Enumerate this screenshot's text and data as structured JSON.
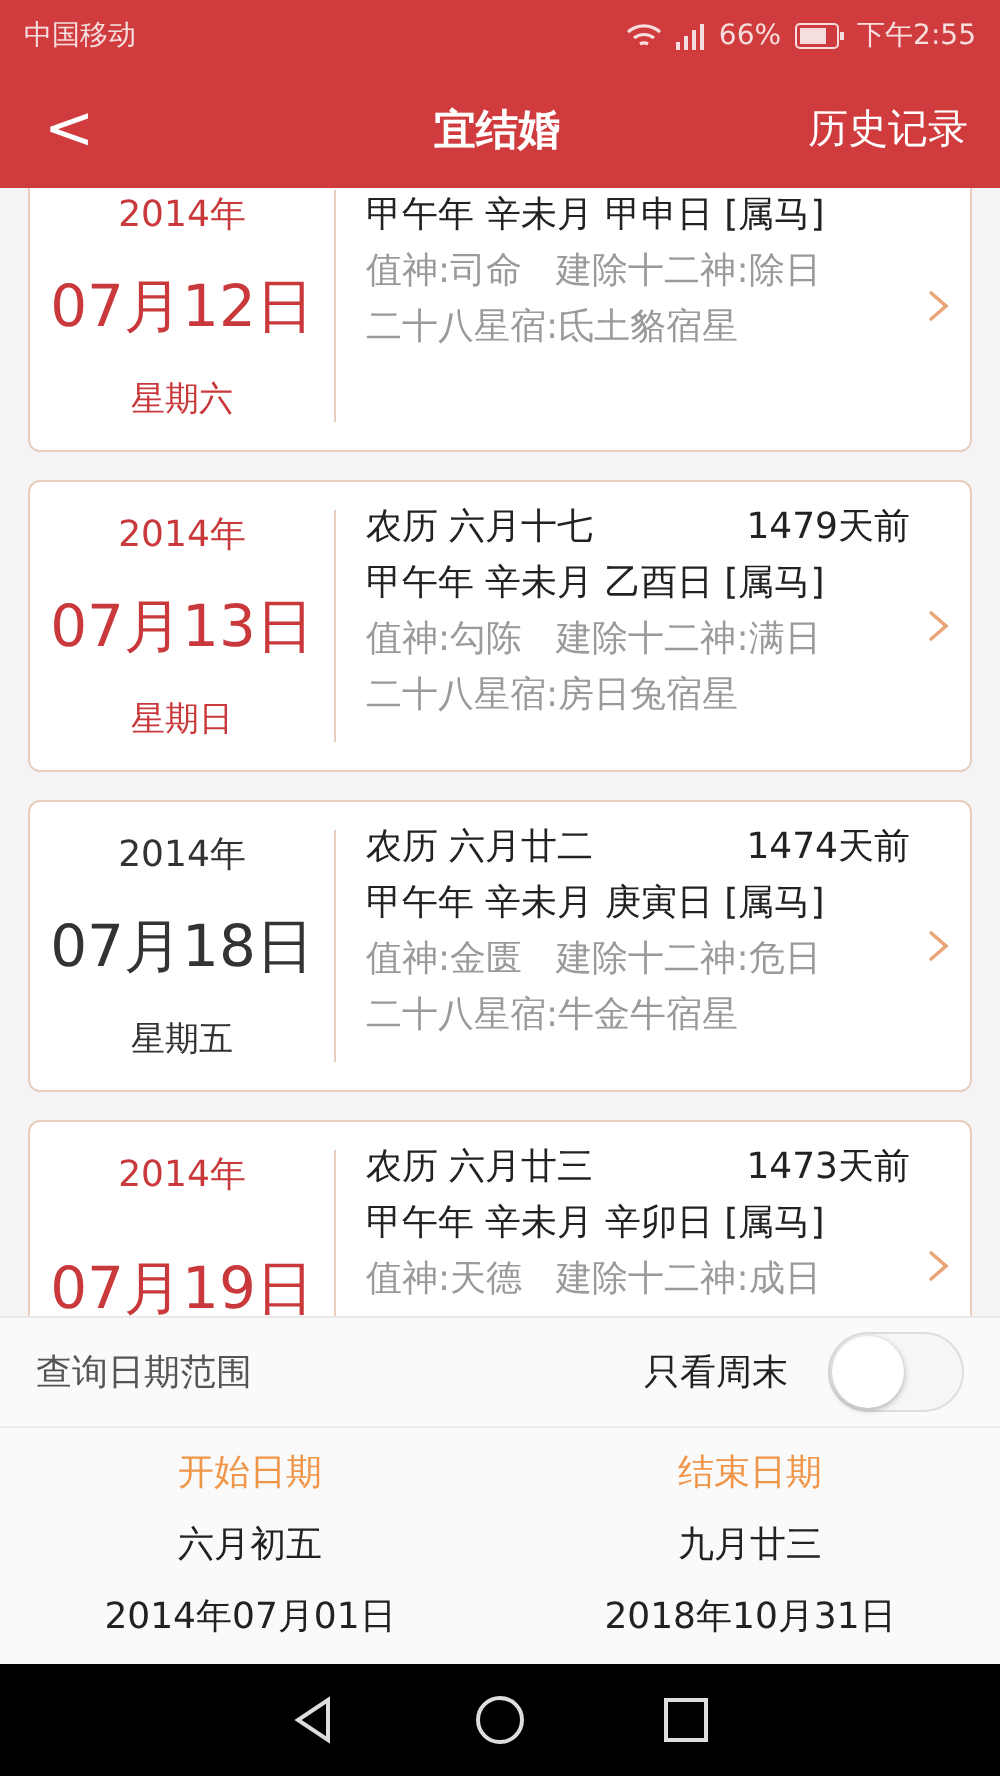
{
  "status_bar": {
    "carrier": "中国移动",
    "battery": "66%",
    "time": "下午2:55"
  },
  "header": {
    "back": "<",
    "title": "宜结婚",
    "action": "历史记录"
  },
  "days": [
    {
      "year": "2014年",
      "date": "07月12日",
      "weekday": "星期六",
      "weekend": true,
      "ganzhi": "甲午年 辛未月 甲申日 [属马]",
      "gods": "值神:司命   建除十二神:除日",
      "stars": "二十八星宿:氐土貉宿星"
    },
    {
      "year": "2014年",
      "date": "07月13日",
      "weekday": "星期日",
      "weekend": true,
      "lunar": "农历 六月十七",
      "ago": "1479天前",
      "ganzhi": "甲午年 辛未月 乙酉日 [属马]",
      "gods": "值神:勾陈   建除十二神:满日",
      "stars": "二十八星宿:房日兔宿星"
    },
    {
      "year": "2014年",
      "date": "07月18日",
      "weekday": "星期五",
      "weekend": false,
      "lunar": "农历 六月廿二",
      "ago": "1474天前",
      "ganzhi": "甲午年 辛未月 庚寅日 [属马]",
      "gods": "值神:金匮   建除十二神:危日",
      "stars": "二十八星宿:牛金牛宿星"
    },
    {
      "year": "2014年",
      "date": "07月19日",
      "weekend": true,
      "lunar": "农历 六月廿三",
      "ago": "1473天前",
      "ganzhi": "甲午年 辛未月 辛卯日 [属马]",
      "gods": "值神:天德   建除十二神:成日"
    }
  ],
  "filter": {
    "label": "查询日期范围",
    "weekend_label": "只看周末",
    "weekend_only": false
  },
  "range": [
    {
      "label": "开始日期",
      "lunar": "六月初五",
      "date": "2014年07月01日"
    },
    {
      "label": "结束日期",
      "lunar": "九月廿三",
      "date": "2018年10月31日"
    }
  ]
}
